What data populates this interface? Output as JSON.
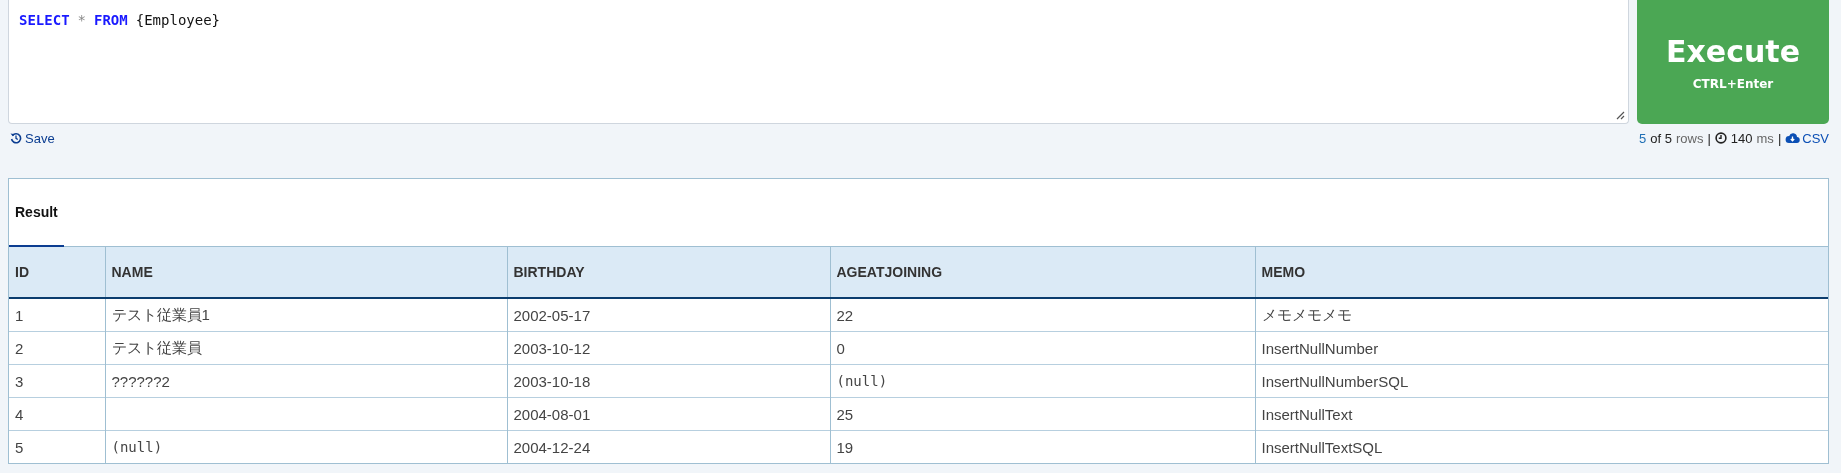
{
  "editor": {
    "tokens": [
      {
        "text": "SELECT",
        "kind": "keyword"
      },
      {
        "text": "*",
        "kind": "operator"
      },
      {
        "text": "FROM",
        "kind": "keyword"
      },
      {
        "text": "{Employee}",
        "kind": "identifier"
      }
    ]
  },
  "execute_button": {
    "label": "Execute",
    "shortcut": "CTRL+Enter"
  },
  "save_link": {
    "label": "Save"
  },
  "status": {
    "row_count": "5",
    "of_total": "of 5",
    "rows_label": "rows",
    "separator_1": "|",
    "elapsed": "140",
    "elapsed_unit": "ms",
    "separator_2": "|",
    "csv_link": "CSV"
  },
  "tabs": [
    {
      "label": "Result",
      "selected": true
    }
  ],
  "table": {
    "columns": [
      "ID",
      "NAME",
      "BIRTHDAY",
      "AGEATJOINING",
      "MEMO"
    ],
    "rows": [
      [
        {
          "text": "1",
          "kind": "value"
        },
        {
          "text": "テスト従業員1",
          "kind": "value"
        },
        {
          "text": "2002-05-17",
          "kind": "value"
        },
        {
          "text": "22",
          "kind": "value"
        },
        {
          "text": "メモメモメモ",
          "kind": "value"
        }
      ],
      [
        {
          "text": "2",
          "kind": "value"
        },
        {
          "text": "テスト従業員",
          "kind": "value"
        },
        {
          "text": "2003-10-12",
          "kind": "value"
        },
        {
          "text": "0",
          "kind": "value"
        },
        {
          "text": "InsertNullNumber",
          "kind": "value"
        }
      ],
      [
        {
          "text": "3",
          "kind": "value"
        },
        {
          "text": "??????2",
          "kind": "value"
        },
        {
          "text": "2003-10-18",
          "kind": "value"
        },
        {
          "text": "(null)",
          "kind": "null"
        },
        {
          "text": "InsertNullNumberSQL",
          "kind": "value"
        }
      ],
      [
        {
          "text": "4",
          "kind": "value"
        },
        {
          "kind": "empty"
        },
        {
          "text": "2004-08-01",
          "kind": "value"
        },
        {
          "text": "25",
          "kind": "value"
        },
        {
          "text": "InsertNullText",
          "kind": "value"
        }
      ],
      [
        {
          "text": "5",
          "kind": "value"
        },
        {
          "text": "(null)",
          "kind": "null"
        },
        {
          "text": "2004-12-24",
          "kind": "value"
        },
        {
          "text": "19",
          "kind": "value"
        },
        {
          "text": "InsertNullTextSQL",
          "kind": "value"
        }
      ]
    ]
  }
}
